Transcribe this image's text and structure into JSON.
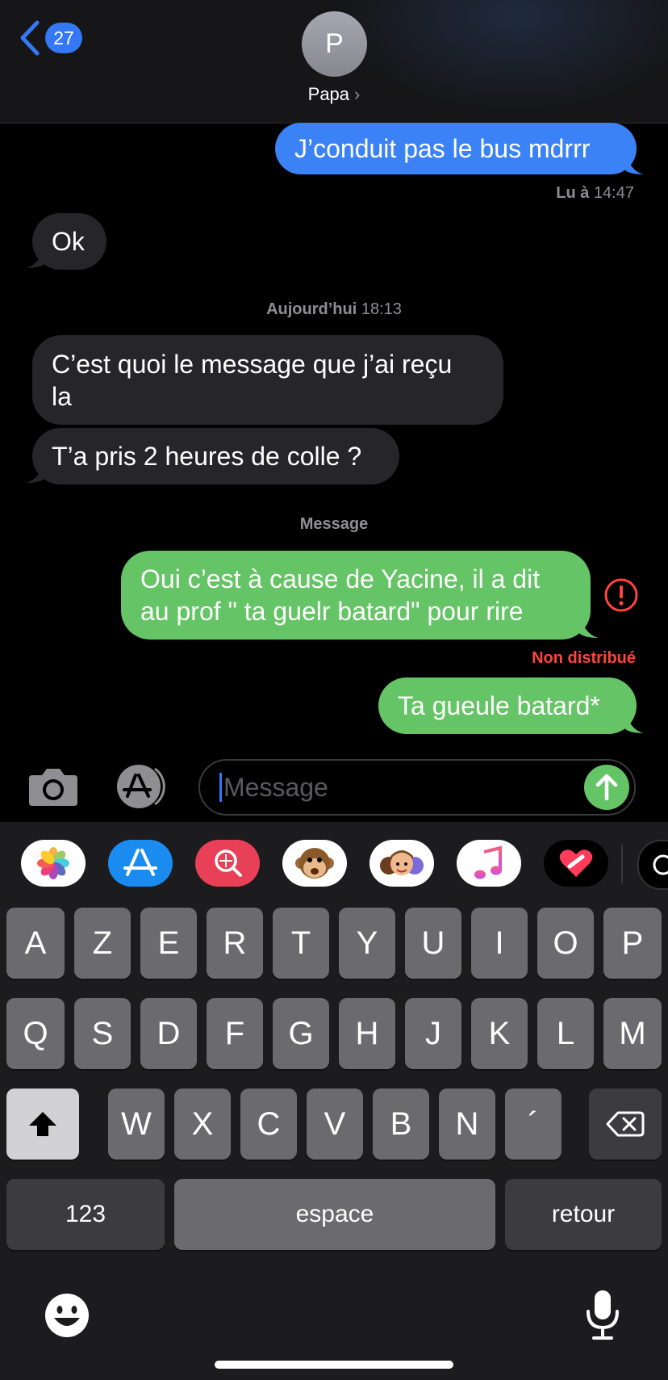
{
  "header": {
    "unread_count": "27",
    "avatar_initial": "P",
    "contact_name": "Papa",
    "chevron": "›"
  },
  "messages": [
    {
      "direction": "outgoing",
      "color": "#3b82f6",
      "text": "J’conduit pas le bus mdrrr"
    },
    {
      "type": "receipt",
      "bold": "Lu à",
      "time": "14:47"
    },
    {
      "direction": "incoming",
      "text": "Ok"
    },
    {
      "type": "timestamp",
      "bold": "Aujourd’hui",
      "time": "18:13"
    },
    {
      "direction": "incoming",
      "text_line1": "C’est quoi le message que j’ai reçu",
      "text_line2": "la"
    },
    {
      "direction": "incoming",
      "text": "T’a pris 2 heures de colle ?"
    },
    {
      "type": "label",
      "text": "Message"
    },
    {
      "direction": "outgoing",
      "color": "#65c466",
      "text_line1": "Oui c’est à cause de Yacine, il a dit",
      "text_line2": "au prof \" ta guelr batard\" pour rire",
      "error_icon": "exclamation-circle-icon"
    },
    {
      "type": "status",
      "text": "Non distribué",
      "color": "#ff453a"
    },
    {
      "direction": "outgoing",
      "color": "#65c466",
      "text": "Ta gueule batard*"
    }
  ],
  "input": {
    "placeholder": "Message",
    "left_icons": [
      "camera-icon",
      "app-store-icon"
    ],
    "send_icon": "arrow-up-icon"
  },
  "app_strip": [
    "photos-icon",
    "app-store-icon",
    "image-search-icon",
    "monkey-memoji-icon",
    "memoji-group-icon",
    "music-icon",
    "digital-touch-icon",
    "more-apps-icon"
  ],
  "keyboard": {
    "row1": [
      "A",
      "Z",
      "E",
      "R",
      "T",
      "Y",
      "U",
      "I",
      "O",
      "P"
    ],
    "row2": [
      "Q",
      "S",
      "D",
      "F",
      "G",
      "H",
      "J",
      "K",
      "L",
      "M"
    ],
    "row3": [
      "W",
      "X",
      "C",
      "V",
      "B",
      "N",
      "´"
    ],
    "numbers_label": "123",
    "space_label": "espace",
    "return_label": "retour",
    "shift_icon": "shift-icon",
    "delete_icon": "delete-icon",
    "emoji_icon": "emoji-icon",
    "mic_icon": "microphone-icon"
  }
}
